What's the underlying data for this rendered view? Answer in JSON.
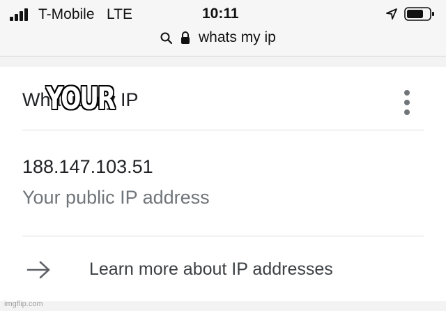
{
  "status_bar": {
    "carrier": "T-Mobile",
    "network": "LTE",
    "time": "10:11",
    "location_icon": "location-arrow-icon",
    "battery_icon": "battery-icon",
    "signal_icon": "cellular-signal-icon"
  },
  "url_bar": {
    "search_icon": "search-icon",
    "lock_icon": "lock-icon",
    "query": "whats my ip"
  },
  "card": {
    "title": "What is my IP",
    "overlay_text": "YOUR",
    "menu_icon": "more-vert-icon",
    "ip_address": "188.147.103.51",
    "ip_caption": "Your public IP address",
    "learn_more": {
      "icon": "arrow-right-icon",
      "label": "Learn more about IP addresses"
    }
  },
  "watermark": "imgflip.com",
  "colors": {
    "card_background": "#ffffff",
    "page_background": "#f3f3f3",
    "secondary_text": "#70757a",
    "divider": "#dadce0"
  }
}
